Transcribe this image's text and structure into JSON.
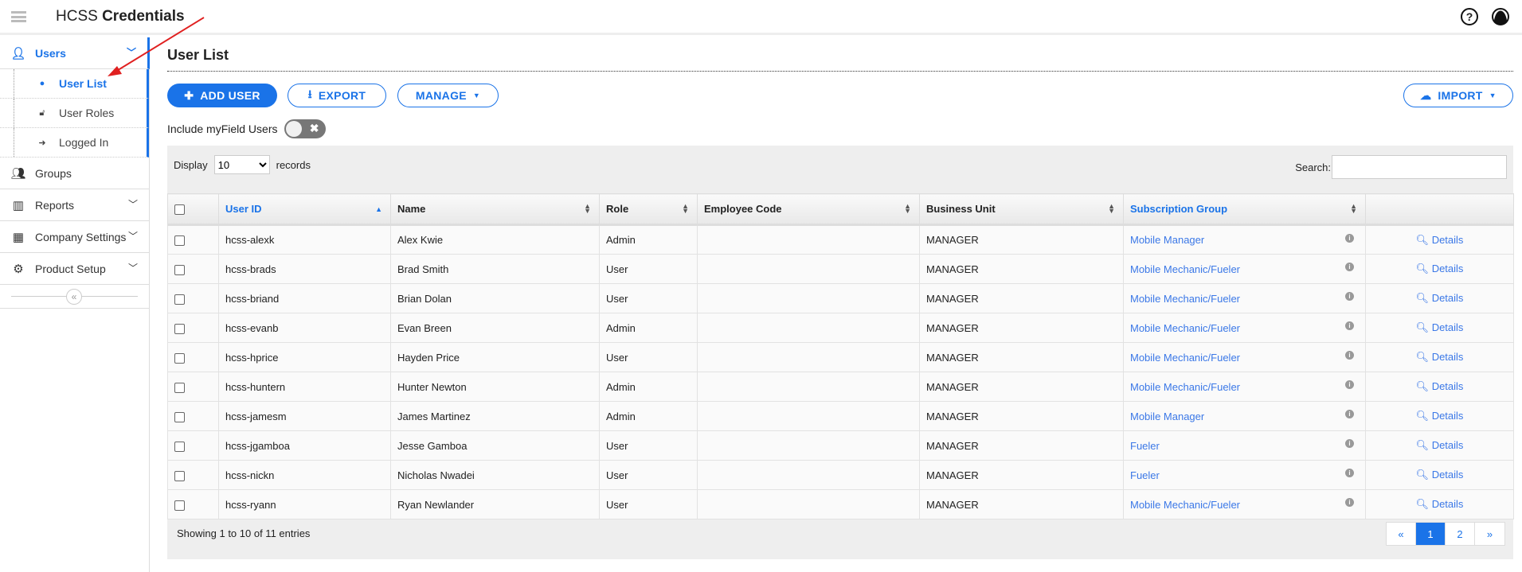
{
  "app": {
    "brand_light": "HCSS",
    "brand_bold": "Credentials"
  },
  "header": {
    "help_icon": "?",
    "account_icon": "user-circle"
  },
  "sidebar": {
    "users": "Users",
    "subitems": [
      {
        "label": "User List"
      },
      {
        "label": "User Roles"
      },
      {
        "label": "Logged In"
      }
    ],
    "items": [
      {
        "label": "Groups"
      },
      {
        "label": "Reports"
      },
      {
        "label": "Company Settings"
      },
      {
        "label": "Product Setup"
      }
    ],
    "collapse": "«"
  },
  "page": {
    "title": "User List"
  },
  "toolbar": {
    "add_user": "ADD USER",
    "export": "EXPORT",
    "manage": "MANAGE",
    "import": "IMPORT",
    "include_label": "Include myField Users",
    "toggle_glyph": "✖"
  },
  "table_controls": {
    "display_label": "Display",
    "display_value": "10",
    "records_label": "records",
    "search_label": "Search:"
  },
  "columns": [
    "User ID",
    "Name",
    "Role",
    "Employee Code",
    "Business Unit",
    "Subscription Group"
  ],
  "rows": [
    {
      "id": "hcss-alexk",
      "name": "Alex Kwie",
      "role": "Admin",
      "code": "",
      "unit": "MANAGER",
      "group": "Mobile Manager",
      "details": "Details"
    },
    {
      "id": "hcss-brads",
      "name": "Brad Smith",
      "role": "User",
      "code": "",
      "unit": "MANAGER",
      "group": "Mobile Mechanic/Fueler",
      "details": "Details"
    },
    {
      "id": "hcss-briand",
      "name": "Brian Dolan",
      "role": "User",
      "code": "",
      "unit": "MANAGER",
      "group": "Mobile Mechanic/Fueler",
      "details": "Details"
    },
    {
      "id": "hcss-evanb",
      "name": "Evan Breen",
      "role": "Admin",
      "code": "",
      "unit": "MANAGER",
      "group": "Mobile Mechanic/Fueler",
      "details": "Details"
    },
    {
      "id": "hcss-hprice",
      "name": "Hayden Price",
      "role": "User",
      "code": "",
      "unit": "MANAGER",
      "group": "Mobile Mechanic/Fueler",
      "details": "Details"
    },
    {
      "id": "hcss-huntern",
      "name": "Hunter Newton",
      "role": "Admin",
      "code": "",
      "unit": "MANAGER",
      "group": "Mobile Mechanic/Fueler",
      "details": "Details"
    },
    {
      "id": "hcss-jamesm",
      "name": "James Martinez",
      "role": "Admin",
      "code": "",
      "unit": "MANAGER",
      "group": "Mobile Manager",
      "details": "Details"
    },
    {
      "id": "hcss-jgamboa",
      "name": "Jesse Gamboa",
      "role": "User",
      "code": "",
      "unit": "MANAGER",
      "group": "Fueler",
      "details": "Details"
    },
    {
      "id": "hcss-nickn",
      "name": "Nicholas Nwadei",
      "role": "User",
      "code": "",
      "unit": "MANAGER",
      "group": "Fueler",
      "details": "Details"
    },
    {
      "id": "hcss-ryann",
      "name": "Ryan Newlander",
      "role": "User",
      "code": "",
      "unit": "MANAGER",
      "group": "Mobile Mechanic/Fueler",
      "details": "Details"
    }
  ],
  "footer": {
    "showing": "Showing 1 to 10 of 11 entries",
    "prev": "«",
    "pages": [
      "1",
      "2"
    ],
    "next": "»"
  },
  "colors": {
    "accent": "#1a73e8",
    "annotation_arrow": "#e02020"
  }
}
